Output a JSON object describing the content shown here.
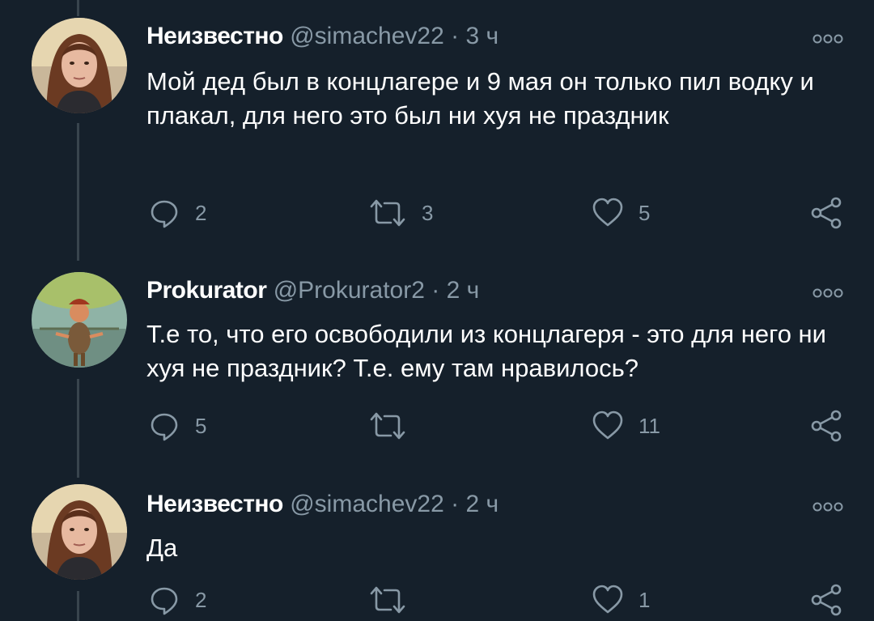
{
  "tweets": [
    {
      "author_name": "Неизвестно",
      "handle": "@simachev22",
      "separator": "·",
      "time": "3 ч",
      "text": "Мой дед был в концлагере и 9 мая он только пил водку и плакал, для него это был ни хуя не праздник",
      "replies": "2",
      "retweets": "3",
      "likes": "5",
      "avatar_icon": "woman-portrait-avatar"
    },
    {
      "author_name": "Prokurator",
      "handle": "@Prokurator2",
      "separator": "·",
      "time": "2 ч",
      "text": "Т.е то, что его освободили из концлагеря - это для него ни хуя не праздник? Т.е. ему там нравилось?",
      "replies": "5",
      "retweets": "",
      "likes": "11",
      "avatar_icon": "cartoon-character-avatar"
    },
    {
      "author_name": "Неизвестно",
      "handle": "@simachev22",
      "separator": "·",
      "time": "2 ч",
      "text": "Да",
      "replies": "2",
      "retweets": "",
      "likes": "1",
      "avatar_icon": "woman-portrait-avatar"
    }
  ],
  "icons": {
    "reply": "reply-bubble-icon",
    "retweet": "retweet-arrows-icon",
    "like": "heart-icon",
    "share": "share-icon",
    "more": "more-dots-icon"
  },
  "colors": {
    "background": "#15202b",
    "secondary_text": "#8899a6",
    "thread_line": "#38444d"
  }
}
